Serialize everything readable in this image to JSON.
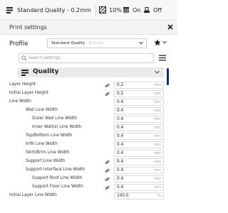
{
  "toolbar": {
    "quality_label": "Standard Quality - 0.2mm",
    "infill_value": "10%",
    "support_value": "On",
    "adhesion_value": "Off"
  },
  "panel": {
    "title": "Print settings",
    "profile_label": "Profile",
    "profile_value": "Standard Quality",
    "profile_subtext": "- 0.2mm",
    "search_placeholder": "Search settings"
  },
  "category": {
    "label": "Quality"
  },
  "settings": [
    {
      "label": "Layer Height",
      "value": "0.2",
      "unit": "mm",
      "linked": true
    },
    {
      "label": "Initial Layer Height",
      "value": "0.2",
      "unit": "mm",
      "linked": true
    },
    {
      "label": "Line Width",
      "value": "0.4",
      "unit": "mm",
      "linked": false
    },
    {
      "label": "Wall Line Width",
      "value": "0.4",
      "unit": "mm",
      "linked": false
    },
    {
      "label": "Outer Wall Line Width",
      "value": "0.4",
      "unit": "mm",
      "linked": false
    },
    {
      "label": "Inner Wall(s) Line Width",
      "value": "0.4",
      "unit": "mm",
      "linked": false
    },
    {
      "label": "Top/Bottom Line Width",
      "value": "0.4",
      "unit": "mm",
      "linked": false
    },
    {
      "label": "Infill Line Width",
      "value": "0.4",
      "unit": "mm",
      "linked": false
    },
    {
      "label": "Skirt/Brim Line Width",
      "value": "0.4",
      "unit": "mm",
      "linked": false
    },
    {
      "label": "Support Line Width",
      "value": "0.4",
      "unit": "mm",
      "linked": true
    },
    {
      "label": "Support Interface Line Width",
      "value": "0.4",
      "unit": "mm",
      "linked": true
    },
    {
      "label": "Support Roof Line Width",
      "value": "0.4",
      "unit": "mm",
      "linked": true
    },
    {
      "label": "Support Floor Line Width",
      "value": "0.4",
      "unit": "mm",
      "linked": true
    },
    {
      "label": "Initial Layer Line Width",
      "value": "100.0",
      "unit": "%",
      "linked": false
    }
  ],
  "colors": {
    "accent": "#152b6b",
    "header_bg": "#f3f3f3",
    "category_bg": "#eaeaea"
  },
  "icons": [
    "printer-icon",
    "infill-icon",
    "support-icon",
    "adhesion-icon",
    "close-icon",
    "star-icon",
    "search-icon",
    "menu-icon",
    "quality-icon",
    "link-icon"
  ]
}
